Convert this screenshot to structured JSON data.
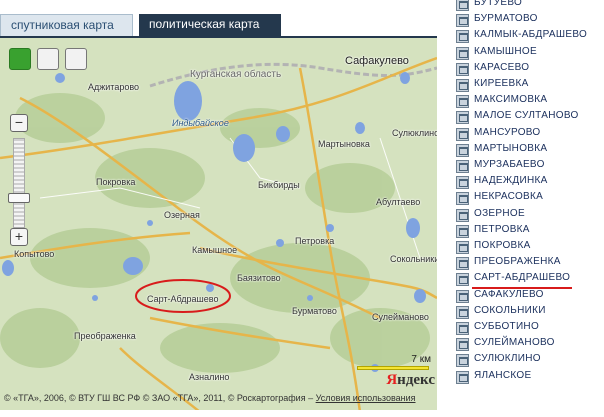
{
  "tabs": {
    "satellite": "спутниковая карта",
    "political": "политическая карта"
  },
  "map": {
    "region_label": "Курганская область",
    "lake_label": "Индыбайское",
    "places": [
      {
        "id": "safakulevo-top",
        "name": "Сафакулево"
      },
      {
        "id": "adzhitarovo",
        "name": "Аджитарово"
      },
      {
        "id": "martynovka",
        "name": "Мартыновка"
      },
      {
        "id": "sulyuklino",
        "name": "Сулюклино"
      },
      {
        "id": "pokrovka",
        "name": "Покровка"
      },
      {
        "id": "bikbirdy",
        "name": "Бикбирды"
      },
      {
        "id": "abutaevo",
        "name": "Абултаево"
      },
      {
        "id": "ozernaya",
        "name": "Озерная"
      },
      {
        "id": "kopytovo",
        "name": "Копытово"
      },
      {
        "id": "kamyshnoe",
        "name": "Камышное"
      },
      {
        "id": "petrovka",
        "name": "Петровка"
      },
      {
        "id": "sokolniki",
        "name": "Сокольники"
      },
      {
        "id": "bayazitovo",
        "name": "Баязитово"
      },
      {
        "id": "sart-abdrashevo",
        "name": "Сарт-Абдрашево"
      },
      {
        "id": "burmatovo",
        "name": "Бурматово"
      },
      {
        "id": "suleimanovo",
        "name": "Сулейманово"
      },
      {
        "id": "preobrazhenka",
        "name": "Преображенка"
      },
      {
        "id": "aznalino",
        "name": "Азналино"
      }
    ],
    "scale_label": "7 км",
    "logo_first": "Я",
    "logo_rest": "ндекс",
    "copyright": "© «ТГА», 2006, © ВТУ ГШ ВС РФ © ЗАО «ТГА», 2011, © Роскартография –",
    "terms_link": "Условия использования",
    "highlight_color": "#d81b1b"
  },
  "list": {
    "items": [
      "БУТУЕВО",
      "БУРМАТОВО",
      "КАЛМЫК-АБДРАШЕВО",
      "КАМЫШНОЕ",
      "КАРАСЕВО",
      "КИРЕЕВКА",
      "МАКСИМОВКА",
      "МАЛОЕ СУЛТАНОВО",
      "МАНСУРОВО",
      "МАРТЫНОВКА",
      "МУРЗАБАЕВО",
      "НАДЕЖДИНКА",
      "НЕКРАСОВКА",
      "ОЗЕРНОЕ",
      "ПЕТРОВКА",
      "ПОКРОВКА",
      "ПРЕОБРАЖЕНКА",
      "САРТ-АБДРАШЕВО",
      "САФАКУЛЕВО",
      "СОКОЛЬНИКИ",
      "СУББОТИНО",
      "СУЛЕЙМАНОВО",
      "СУЛЮКЛИНО",
      "ЯЛАНСКОЕ"
    ],
    "highlighted_index": 17
  }
}
